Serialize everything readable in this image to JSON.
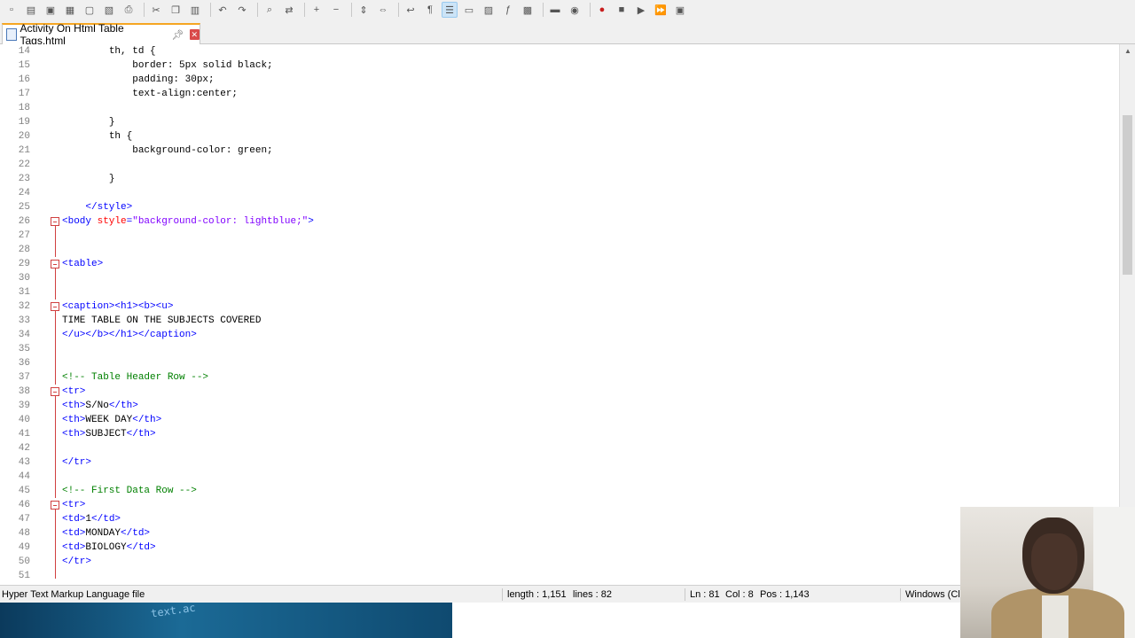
{
  "toolbar": {
    "icons": [
      "new-file-icon",
      "open-file-icon",
      "save-icon",
      "save-all-icon",
      "close-icon",
      "close-all-icon",
      "print-icon",
      "cut-icon",
      "copy-icon",
      "paste-icon",
      "undo-icon",
      "redo-icon",
      "find-icon",
      "replace-icon",
      "zoom-in-icon",
      "zoom-out-icon",
      "sync-vertical-icon",
      "sync-horizontal-icon",
      "word-wrap-icon",
      "show-all-chars-icon",
      "indent-guide-icon",
      "user-lang-icon",
      "doc-map-icon",
      "function-list-icon",
      "folder-workspace-icon",
      "doc-switcher-icon",
      "monitor-icon",
      "record-macro-icon",
      "stop-macro-icon",
      "play-macro-icon",
      "run-macro-multiple-icon",
      "save-macro-icon"
    ]
  },
  "tab": {
    "title": "Activity On Html Table Tags.html"
  },
  "editor": {
    "lines": [
      {
        "n": "14",
        "indent": "        ",
        "parts": [
          [
            "c-text",
            "th, td {"
          ]
        ]
      },
      {
        "n": "15",
        "indent": "            ",
        "parts": [
          [
            "c-text",
            "border: 5px solid black;"
          ]
        ]
      },
      {
        "n": "16",
        "indent": "            ",
        "parts": [
          [
            "c-text",
            "padding: 30px;"
          ]
        ]
      },
      {
        "n": "17",
        "indent": "            ",
        "parts": [
          [
            "c-text",
            "text-align:center;"
          ]
        ]
      },
      {
        "n": "18",
        "indent": "",
        "parts": []
      },
      {
        "n": "19",
        "indent": "        ",
        "parts": [
          [
            "c-text",
            "}"
          ]
        ]
      },
      {
        "n": "20",
        "indent": "        ",
        "parts": [
          [
            "c-text",
            "th {"
          ]
        ]
      },
      {
        "n": "21",
        "indent": "            ",
        "parts": [
          [
            "c-text",
            "background-color: green;"
          ]
        ]
      },
      {
        "n": "22",
        "indent": "",
        "parts": []
      },
      {
        "n": "23",
        "indent": "        ",
        "parts": [
          [
            "c-text",
            "}"
          ]
        ]
      },
      {
        "n": "24",
        "indent": "",
        "parts": []
      },
      {
        "n": "25",
        "indent": "    ",
        "parts": [
          [
            "c-tag",
            "</style>"
          ]
        ]
      },
      {
        "n": "26",
        "indent": "",
        "fold": "box",
        "parts": [
          [
            "c-tag",
            "<body "
          ],
          [
            "c-attr",
            "style"
          ],
          [
            "c-tag",
            "="
          ],
          [
            "c-val",
            "\"background-color: lightblue;\""
          ],
          [
            "c-tag",
            ">"
          ]
        ]
      },
      {
        "n": "27",
        "indent": "",
        "fold": "line",
        "parts": []
      },
      {
        "n": "28",
        "indent": "",
        "fold": "line",
        "parts": []
      },
      {
        "n": "29",
        "indent": "",
        "fold": "box",
        "parts": [
          [
            "c-tag",
            "<table>"
          ]
        ]
      },
      {
        "n": "30",
        "indent": "",
        "fold": "line",
        "parts": []
      },
      {
        "n": "31",
        "indent": "",
        "fold": "line",
        "parts": []
      },
      {
        "n": "32",
        "indent": "",
        "fold": "box",
        "parts": [
          [
            "c-tag",
            "<caption><h1><b><u>"
          ]
        ]
      },
      {
        "n": "33",
        "indent": "",
        "fold": "line",
        "parts": [
          [
            "c-text",
            "TIME TABLE ON THE SUBJECTS COVERED"
          ]
        ]
      },
      {
        "n": "34",
        "indent": "",
        "fold": "line",
        "parts": [
          [
            "c-tag",
            "</u></b></h1></caption>"
          ]
        ]
      },
      {
        "n": "35",
        "indent": "",
        "fold": "line",
        "parts": []
      },
      {
        "n": "36",
        "indent": "",
        "fold": "line",
        "parts": []
      },
      {
        "n": "37",
        "indent": "",
        "fold": "line",
        "parts": [
          [
            "c-comment",
            "<!-- Table Header Row -->"
          ]
        ]
      },
      {
        "n": "38",
        "indent": "",
        "fold": "box",
        "parts": [
          [
            "c-tag",
            "<tr>"
          ]
        ]
      },
      {
        "n": "39",
        "indent": "",
        "fold": "line",
        "parts": [
          [
            "c-tag",
            "<th>"
          ],
          [
            "c-text",
            "S/No"
          ],
          [
            "c-tag",
            "</th>"
          ]
        ]
      },
      {
        "n": "40",
        "indent": "",
        "fold": "line",
        "parts": [
          [
            "c-tag",
            "<th>"
          ],
          [
            "c-text",
            "WEEK DAY"
          ],
          [
            "c-tag",
            "</th>"
          ]
        ]
      },
      {
        "n": "41",
        "indent": "",
        "fold": "line",
        "parts": [
          [
            "c-tag",
            "<th>"
          ],
          [
            "c-text",
            "SUBJECT"
          ],
          [
            "c-tag",
            "</th>"
          ]
        ]
      },
      {
        "n": "42",
        "indent": "",
        "fold": "line",
        "parts": []
      },
      {
        "n": "43",
        "indent": "",
        "fold": "line",
        "parts": [
          [
            "c-tag",
            "</tr>"
          ]
        ]
      },
      {
        "n": "44",
        "indent": "",
        "fold": "line",
        "parts": []
      },
      {
        "n": "45",
        "indent": "",
        "fold": "line",
        "parts": [
          [
            "c-comment",
            "<!-- First Data Row -->"
          ]
        ]
      },
      {
        "n": "46",
        "indent": "",
        "fold": "box",
        "parts": [
          [
            "c-tag",
            "<tr>"
          ]
        ]
      },
      {
        "n": "47",
        "indent": "",
        "fold": "line",
        "parts": [
          [
            "c-tag",
            "<td>"
          ],
          [
            "c-text",
            "1"
          ],
          [
            "c-tag",
            "</td>"
          ]
        ]
      },
      {
        "n": "48",
        "indent": "",
        "fold": "line",
        "parts": [
          [
            "c-tag",
            "<td>"
          ],
          [
            "c-text",
            "MONDAY"
          ],
          [
            "c-tag",
            "</td>"
          ]
        ]
      },
      {
        "n": "49",
        "indent": "",
        "fold": "line",
        "parts": [
          [
            "c-tag",
            "<td>"
          ],
          [
            "c-text",
            "BIOLOGY"
          ],
          [
            "c-tag",
            "</td>"
          ]
        ]
      },
      {
        "n": "50",
        "indent": "",
        "fold": "line",
        "parts": [
          [
            "c-tag",
            "</tr>"
          ]
        ]
      },
      {
        "n": "51",
        "indent": "",
        "fold": "line",
        "parts": []
      }
    ]
  },
  "statusbar": {
    "file_type": "Hyper Text Markup Language file",
    "length": "length : 1,151",
    "lines": "lines : 82",
    "ln": "Ln : 81",
    "col": "Col : 8",
    "pos": "Pos : 1,143",
    "eol": "Windows (Cl"
  },
  "strip": {
    "text": "text.ac"
  }
}
